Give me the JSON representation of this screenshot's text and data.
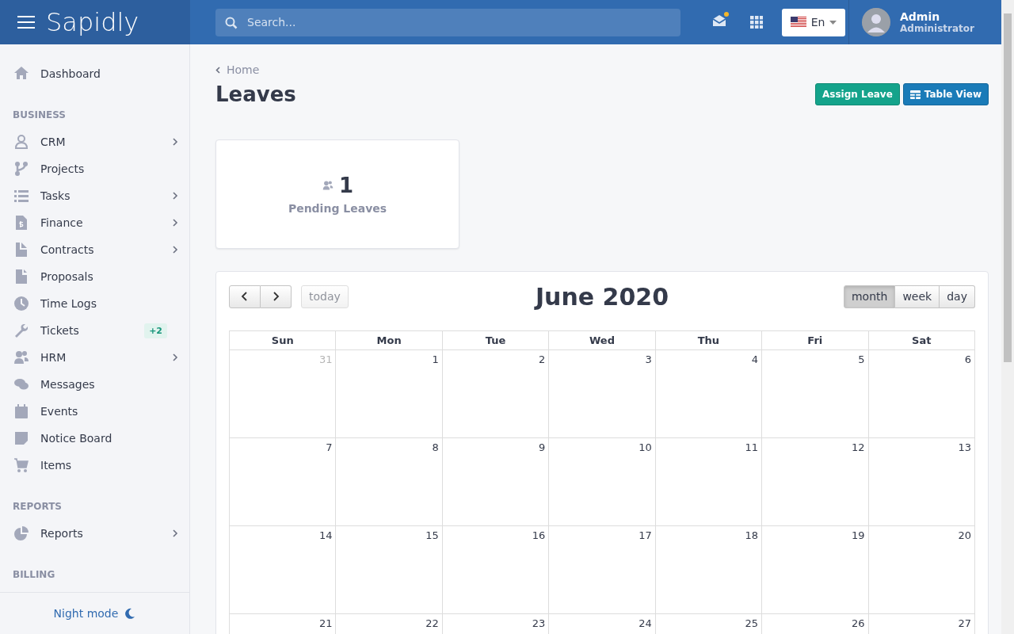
{
  "topbar": {
    "brand": "Sapidly",
    "search": {
      "placeholder": "Search..."
    },
    "notification_dot": true,
    "language": "En",
    "user": {
      "name": "Admin",
      "role": "Administrator"
    }
  },
  "sidebar": {
    "top_items": [
      {
        "label": "Dashboard",
        "has_submenu": false
      }
    ],
    "sections": [
      {
        "title": "BUSINESS",
        "items": [
          {
            "label": "CRM",
            "has_submenu": true
          },
          {
            "label": "Projects",
            "has_submenu": false
          },
          {
            "label": "Tasks",
            "has_submenu": true
          },
          {
            "label": "Finance",
            "has_submenu": true
          },
          {
            "label": "Contracts",
            "has_submenu": true
          },
          {
            "label": "Proposals",
            "has_submenu": false
          },
          {
            "label": "Time Logs",
            "has_submenu": false
          },
          {
            "label": "Tickets",
            "has_submenu": false,
            "badge": "+2"
          },
          {
            "label": "HRM",
            "has_submenu": true
          },
          {
            "label": "Messages",
            "has_submenu": false
          },
          {
            "label": "Events",
            "has_submenu": false
          },
          {
            "label": "Notice Board",
            "has_submenu": false
          },
          {
            "label": "Items",
            "has_submenu": false
          }
        ]
      },
      {
        "title": "REPORTS",
        "items": [
          {
            "label": "Reports",
            "has_submenu": true
          }
        ]
      },
      {
        "title": "BILLING"
      }
    ],
    "night_mode": "Night mode"
  },
  "breadcrumb": "Home",
  "page_title": "Leaves",
  "actions": [
    {
      "label": "Assign Leave",
      "kind": "primary"
    },
    {
      "label": "Table View",
      "kind": "table"
    }
  ],
  "stat_card": {
    "value": "1",
    "label": "Pending Leaves"
  },
  "calendar": {
    "title": "June 2020",
    "today": "today",
    "views": [
      {
        "label": "month",
        "selected": true
      },
      {
        "label": "week",
        "selected": false
      },
      {
        "label": "day",
        "selected": false
      }
    ],
    "weekdays": [
      "Sun",
      "Mon",
      "Tue",
      "Wed",
      "Thu",
      "Fri",
      "Sat"
    ],
    "weeks": [
      [
        {
          "day": "31",
          "other_month": true
        },
        {
          "day": "1",
          "other_month": false
        },
        {
          "day": "2",
          "other_month": false
        },
        {
          "day": "3",
          "other_month": false
        },
        {
          "day": "4",
          "other_month": false
        },
        {
          "day": "5",
          "other_month": false
        },
        {
          "day": "6",
          "other_month": false
        }
      ],
      [
        {
          "day": "7",
          "other_month": false
        },
        {
          "day": "8",
          "other_month": false
        },
        {
          "day": "9",
          "other_month": false
        },
        {
          "day": "10",
          "other_month": false
        },
        {
          "day": "11",
          "other_month": false
        },
        {
          "day": "12",
          "other_month": false
        },
        {
          "day": "13",
          "other_month": false
        }
      ],
      [
        {
          "day": "14",
          "other_month": false
        },
        {
          "day": "15",
          "other_month": false
        },
        {
          "day": "16",
          "other_month": false
        },
        {
          "day": "17",
          "other_month": false
        },
        {
          "day": "18",
          "other_month": false
        },
        {
          "day": "19",
          "other_month": false
        },
        {
          "day": "20",
          "other_month": false
        }
      ],
      [
        {
          "day": "21",
          "other_month": false
        },
        {
          "day": "22",
          "other_month": false
        },
        {
          "day": "23",
          "other_month": false
        },
        {
          "day": "24",
          "other_month": false
        },
        {
          "day": "25",
          "other_month": false
        },
        {
          "day": "26",
          "other_month": false
        },
        {
          "day": "27",
          "other_month": false
        }
      ]
    ]
  }
}
